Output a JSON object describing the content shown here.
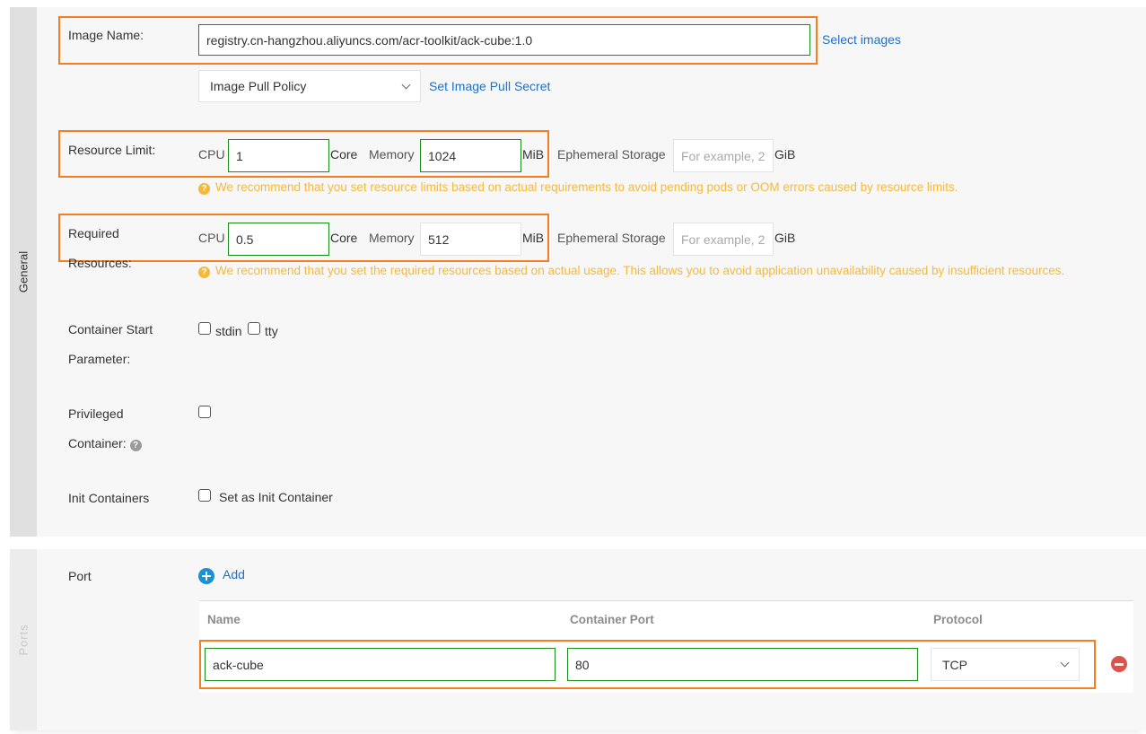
{
  "sections": {
    "general": {
      "title": "General"
    },
    "ports": {
      "title": "Ports"
    }
  },
  "image": {
    "label": "Image Name:",
    "value": "registry.cn-hangzhou.aliyuncs.com/acr-toolkit/ack-cube:1.0",
    "select_link": "Select images",
    "pull_policy": {
      "selected": "Image Pull Policy"
    },
    "pull_secret_link": "Set Image Pull Secret"
  },
  "resource_limit": {
    "label": "Resource Limit:",
    "cpu_label": "CPU",
    "cpu_value": "1",
    "cpu_unit": "Core",
    "memory_label": "Memory",
    "memory_value": "1024",
    "memory_unit": "MiB",
    "storage_label": "Ephemeral Storage",
    "storage_placeholder": "For example, 2",
    "storage_unit": "GiB",
    "hint": "We recommend that you set resource limits based on actual requirements to avoid pending pods or OOM errors caused by resource limits."
  },
  "required_resources": {
    "label_line1": "Required",
    "label_line2": "Resources:",
    "cpu_label": "CPU",
    "cpu_value": "0.5",
    "cpu_unit": "Core",
    "memory_label": "Memory",
    "memory_value": "512",
    "memory_unit": "MiB",
    "storage_label": "Ephemeral Storage",
    "storage_placeholder": "For example, 2",
    "storage_unit": "GiB",
    "hint": "We recommend that you set the required resources based on actual usage. This allows you to avoid application unavailability caused by insufficient resources."
  },
  "start_params": {
    "label_line1": "Container Start",
    "label_line2": "Parameter:",
    "options": [
      {
        "label": "stdin",
        "checked": false
      },
      {
        "label": "tty",
        "checked": false
      }
    ]
  },
  "privileged": {
    "label_line1": "Privileged",
    "label_line2": "Container:",
    "help_icon": "?",
    "checked": false
  },
  "init_containers": {
    "label": "Init Containers",
    "option_label": "Set as Init Container",
    "checked": false
  },
  "port": {
    "label": "Port",
    "add_label": "Add",
    "columns": [
      "Name",
      "Container Port",
      "Protocol"
    ],
    "rows": [
      {
        "name": "ack-cube",
        "container_port": "80",
        "protocol": "TCP"
      }
    ]
  },
  "colors": {
    "highlight_orange": "#f57e20",
    "highlight_green": "#1d8a1d",
    "link_blue": "#1f6fc5",
    "hint_yellow": "#f5b93a",
    "remove_red": "#d9534f",
    "add_blue": "#1b90d3"
  }
}
